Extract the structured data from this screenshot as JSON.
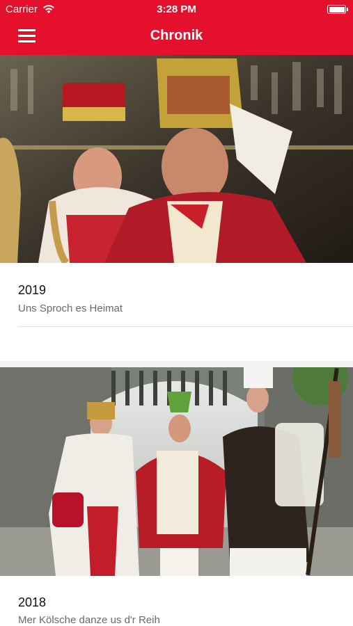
{
  "status_bar": {
    "carrier": "Carrier",
    "time": "3:28 PM"
  },
  "nav": {
    "title": "Chronik",
    "menu_icon": "hamburger-icon"
  },
  "colors": {
    "accent": "#e4102c",
    "subtitle": "#6a6a6a"
  },
  "chronicle": [
    {
      "year": "2019",
      "motto": "Uns Sproch es Heimat"
    },
    {
      "year": "2018",
      "motto": "Mer Kölsche danze us d'r Reih"
    }
  ]
}
